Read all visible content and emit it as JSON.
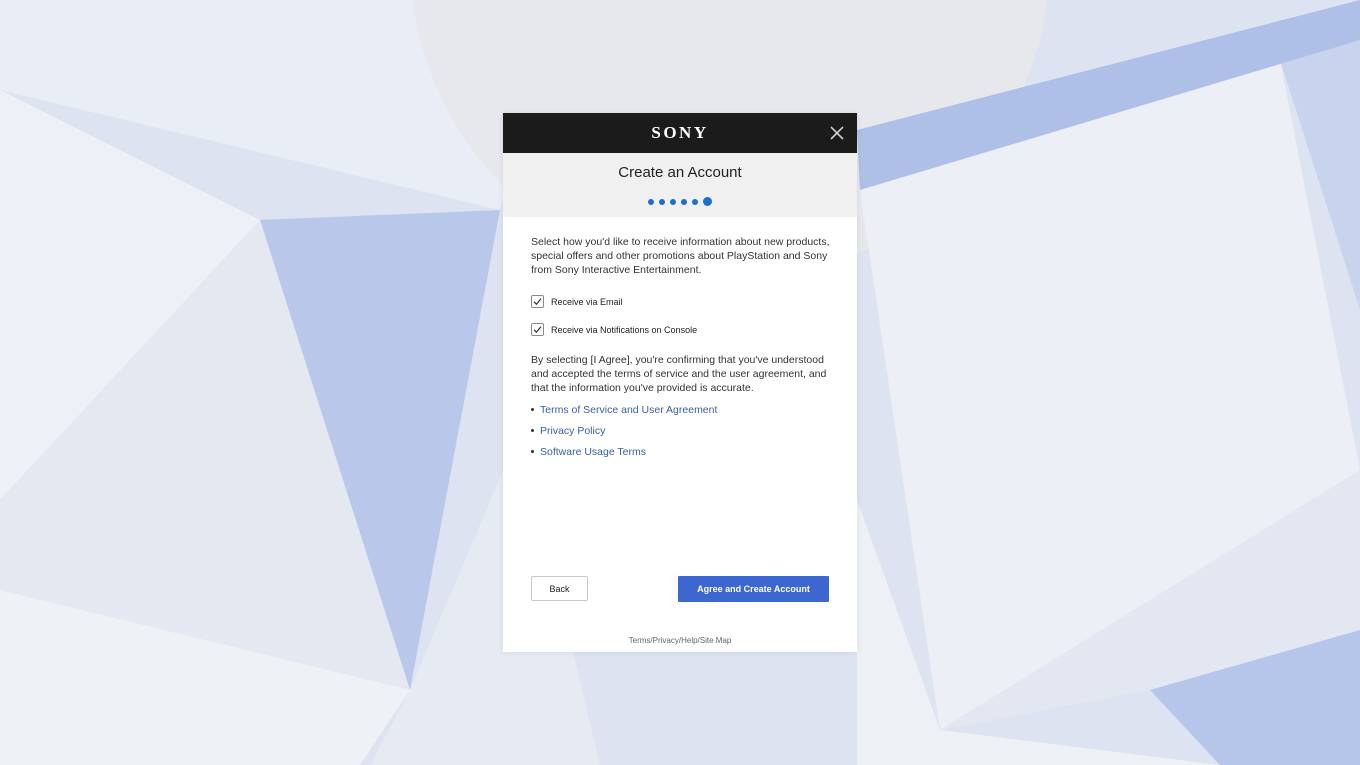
{
  "header": {
    "brand": "SONY",
    "close_icon": "close-icon"
  },
  "page": {
    "title": "Create an Account",
    "steps_total": 6,
    "current_step": 6
  },
  "content": {
    "intro": "Select how you'd like to receive information about new products, special offers and other promotions about PlayStation and Sony from Sony Interactive Entertainment.",
    "options": [
      {
        "label": "Receive via Email",
        "checked": true
      },
      {
        "label": "Receive via Notifications on Console",
        "checked": true
      }
    ],
    "agreement": "By selecting [I Agree], you're confirming that you've understood and accepted the terms of service and the user agreement, and that the information you've provided is accurate.",
    "links": [
      "Terms of Service and User Agreement",
      "Privacy Policy",
      "Software Usage Terms"
    ]
  },
  "buttons": {
    "back": "Back",
    "agree": "Agree and Create Account"
  },
  "footer": {
    "links": "Terms/Privacy/Help/Site Map"
  },
  "colors": {
    "topbar": "#1b1b1b",
    "accent": "#3d67d0",
    "step_dot": "#1f6fc9",
    "link": "#3a5ea6"
  }
}
